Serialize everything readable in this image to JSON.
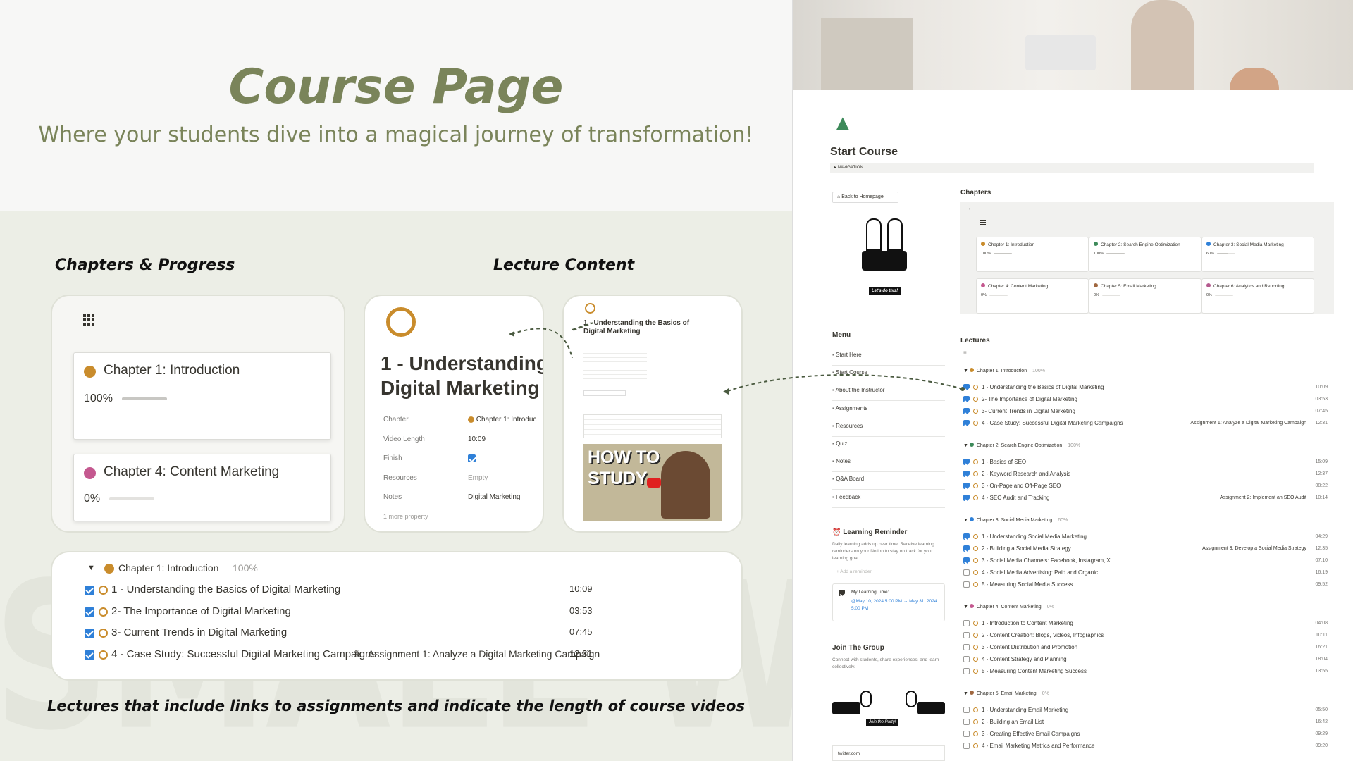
{
  "hero": {
    "title": "Course Page",
    "subtitle": "Where your students dive into a magical journey of transformation!"
  },
  "watermark": "SMALL WINS",
  "labels": {
    "chapters_progress": "Chapters & Progress",
    "lecture_content": "Lecture Content",
    "caption": "Lectures that include links to assignments and indicate the length of course videos"
  },
  "chapter_cards": [
    {
      "name": "Chapter 1: Introduction",
      "progress_label": "100%",
      "progress": 1.0,
      "color": "#c98c2c"
    },
    {
      "name": "Chapter 4: Content Marketing",
      "progress_label": "0%",
      "progress": 0.0,
      "color": "#c4588f"
    }
  ],
  "lecture_page": {
    "title": "1 - Understanding Digital Marketing",
    "props": [
      {
        "icon": "grid-icon",
        "label": "Chapter",
        "value": "Chapter 1: Introduc"
      },
      {
        "icon": "video-icon",
        "label": "Video Length",
        "value": "10:09"
      },
      {
        "icon": "checkbox-icon",
        "label": "Finish",
        "value": ""
      },
      {
        "icon": "resources-icon",
        "label": "Resources",
        "value": "Empty"
      },
      {
        "icon": "notes-icon",
        "label": "Notes",
        "value": "Digital Marketing"
      }
    ],
    "more": "1 more property"
  },
  "lecture_preview": {
    "title": "1 - Understanding the Basics of Digital Marketing",
    "thumb_text": "HOW TO STUDY"
  },
  "lecture_list": {
    "group": "Chapter 1: Introduction",
    "group_pct": "100%",
    "rows": [
      {
        "title": "1 - Understanding the Basics of Digital Marketing",
        "assignment": "",
        "duration": "10:09"
      },
      {
        "title": "2- The Importance of Digital Marketing",
        "assignment": "",
        "duration": "03:53"
      },
      {
        "title": "3- Current Trends in Digital Marketing",
        "assignment": "",
        "duration": "07:45"
      },
      {
        "title": "4 - Case Study: Successful Digital Marketing Campaigns",
        "assignment": "Assignment 1: Analyze a Digital Marketing Campaign",
        "duration": "12:31"
      }
    ]
  },
  "notion": {
    "page_title": "Start Course",
    "nav_label": "NAVIGATION",
    "back_button": "Back to Homepage",
    "lets_do_this": "Let's do this!",
    "menu_heading": "Menu",
    "menu": [
      "Start Here",
      "Start Course",
      "About the Instructor",
      "Assignments",
      "Resources",
      "Quiz",
      "Notes",
      "Q&A Board",
      "Feedback"
    ],
    "reminder_title": "Learning Reminder",
    "reminder_text": "Daily learning adds up over time. Receive learning reminders on your Notion to stay on track for your learning goal.",
    "add_reminder": "Add a reminder",
    "learning_time_label": "My Learning Time:",
    "learning_time_value": "@May 10, 2024 5:00 PM → May 31, 2024 5:00 PM",
    "group_title": "Join The Group",
    "group_text": "Connect with students, share experiences, and learn collectively.",
    "join_party": "Join the Party!",
    "twitter": "twitter.com",
    "chapters_heading": "Chapters",
    "chapters": [
      {
        "name": "Chapter 1: Introduction",
        "pct": "100%",
        "progress": 1.0,
        "color": "#c98c2c"
      },
      {
        "name": "Chapter 2: Search Engine Optimization",
        "pct": "100%",
        "progress": 1.0,
        "color": "#3d8a5a"
      },
      {
        "name": "Chapter 3: Social Media Marketing",
        "pct": "60%",
        "progress": 0.6,
        "color": "#2f80d8"
      },
      {
        "name": "Chapter 4: Content Marketing",
        "pct": "0%",
        "progress": 0.0,
        "color": "#c4588f"
      },
      {
        "name": "Chapter 5: Email Marketing",
        "pct": "0%",
        "progress": 0.0,
        "color": "#a0673f"
      },
      {
        "name": "Chapter 6: Analytics and Reporting",
        "pct": "0%",
        "progress": 0.0,
        "color": "#b45a8e"
      }
    ],
    "lectures_heading": "Lectures",
    "groups": [
      {
        "name": "Chapter 1: Introduction",
        "pct": "100%",
        "color": "#c98c2c",
        "rows": [
          {
            "title": "1 - Understanding the Basics of Digital Marketing",
            "done": true,
            "assignment": "",
            "duration": "10:09"
          },
          {
            "title": "2- The Importance of Digital Marketing",
            "done": true,
            "assignment": "",
            "duration": "03:53"
          },
          {
            "title": "3- Current Trends in Digital Marketing",
            "done": true,
            "assignment": "",
            "duration": "07:45"
          },
          {
            "title": "4 - Case Study: Successful Digital Marketing Campaigns",
            "done": true,
            "assignment": "Assignment 1: Analyze a Digital Marketing Campaign",
            "duration": "12:31"
          }
        ]
      },
      {
        "name": "Chapter 2: Search Engine Optimization",
        "pct": "100%",
        "color": "#3d8a5a",
        "rows": [
          {
            "title": "1 - Basics of SEO",
            "done": true,
            "assignment": "",
            "duration": "15:09"
          },
          {
            "title": "2 - Keyword Research and Analysis",
            "done": true,
            "assignment": "",
            "duration": "12:37"
          },
          {
            "title": "3 - On-Page and Off-Page SEO",
            "done": true,
            "assignment": "",
            "duration": "08:22"
          },
          {
            "title": "4 - SEO Audit and Tracking",
            "done": true,
            "assignment": "Assignment 2: Implement an SEO Audit",
            "duration": "10:14"
          }
        ]
      },
      {
        "name": "Chapter 3: Social Media Marketing",
        "pct": "60%",
        "color": "#2f80d8",
        "rows": [
          {
            "title": "1 - Understanding Social Media Marketing",
            "done": true,
            "assignment": "",
            "duration": "04:29"
          },
          {
            "title": "2 - Building a Social Media Strategy",
            "done": true,
            "assignment": "Assignment 3: Develop a Social Media Strategy",
            "duration": "12:35"
          },
          {
            "title": "3 - Social Media Channels: Facebook, Instagram, X",
            "done": true,
            "assignment": "",
            "duration": "07:10"
          },
          {
            "title": "4 - Social Media Advertising: Paid and Organic",
            "done": false,
            "assignment": "",
            "duration": "16:19"
          },
          {
            "title": "5 - Measuring Social Media Success",
            "done": false,
            "assignment": "",
            "duration": "09:52"
          }
        ]
      },
      {
        "name": "Chapter 4: Content Marketing",
        "pct": "0%",
        "color": "#c4588f",
        "rows": [
          {
            "title": "1 - Introduction to Content Marketing",
            "done": false,
            "assignment": "",
            "duration": "04:08"
          },
          {
            "title": "2 - Content Creation: Blogs, Videos, Infographics",
            "done": false,
            "assignment": "",
            "duration": "10:11"
          },
          {
            "title": "3 - Content Distribution and Promotion",
            "done": false,
            "assignment": "",
            "duration": "16:21"
          },
          {
            "title": "4 - Content Strategy and Planning",
            "done": false,
            "assignment": "",
            "duration": "18:04"
          },
          {
            "title": "5 - Measuring Content Marketing Success",
            "done": false,
            "assignment": "",
            "duration": "13:55"
          }
        ]
      },
      {
        "name": "Chapter 5: Email Marketing",
        "pct": "0%",
        "color": "#a0673f",
        "rows": [
          {
            "title": "1 - Understanding Email Marketing",
            "done": false,
            "assignment": "",
            "duration": "05:50"
          },
          {
            "title": "2 - Building an Email List",
            "done": false,
            "assignment": "",
            "duration": "16:42"
          },
          {
            "title": "3 - Creating Effective Email Campaigns",
            "done": false,
            "assignment": "",
            "duration": "09:29"
          },
          {
            "title": "4 - Email Marketing Metrics and Performance",
            "done": false,
            "assignment": "",
            "duration": "09:20"
          }
        ]
      }
    ]
  }
}
